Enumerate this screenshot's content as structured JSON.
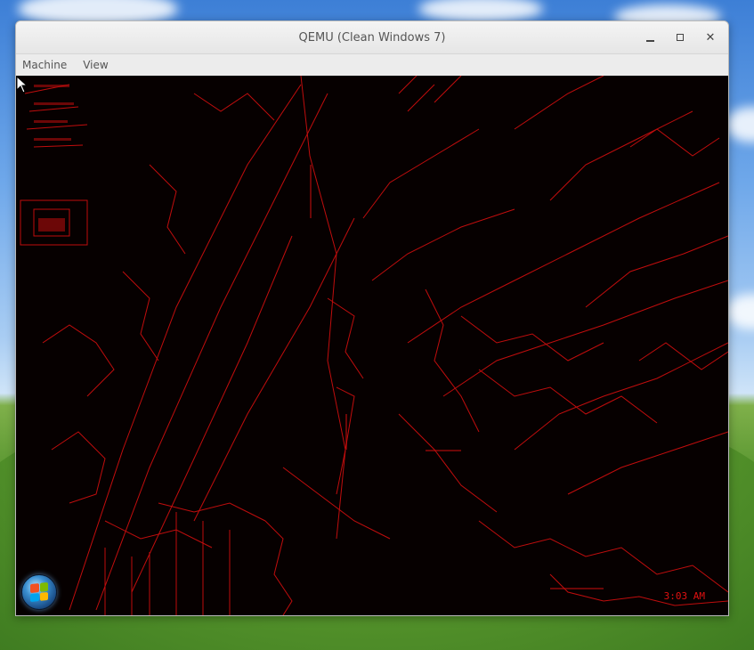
{
  "window": {
    "title": "QEMU (Clean Windows 7)",
    "controls": [
      "minimize",
      "maximize",
      "close"
    ]
  },
  "menu": {
    "items": [
      "Machine",
      "View"
    ]
  },
  "guest": {
    "taskbar_time": "3:03 AM",
    "colors": {
      "edges": "#d40f0f",
      "background": "#060000"
    }
  },
  "icons": {
    "minimize": "minimize-icon",
    "maximize": "maximize-icon",
    "close": "close-icon",
    "start": "windows-start-orb-icon",
    "cursor": "mouse-pointer-icon"
  }
}
